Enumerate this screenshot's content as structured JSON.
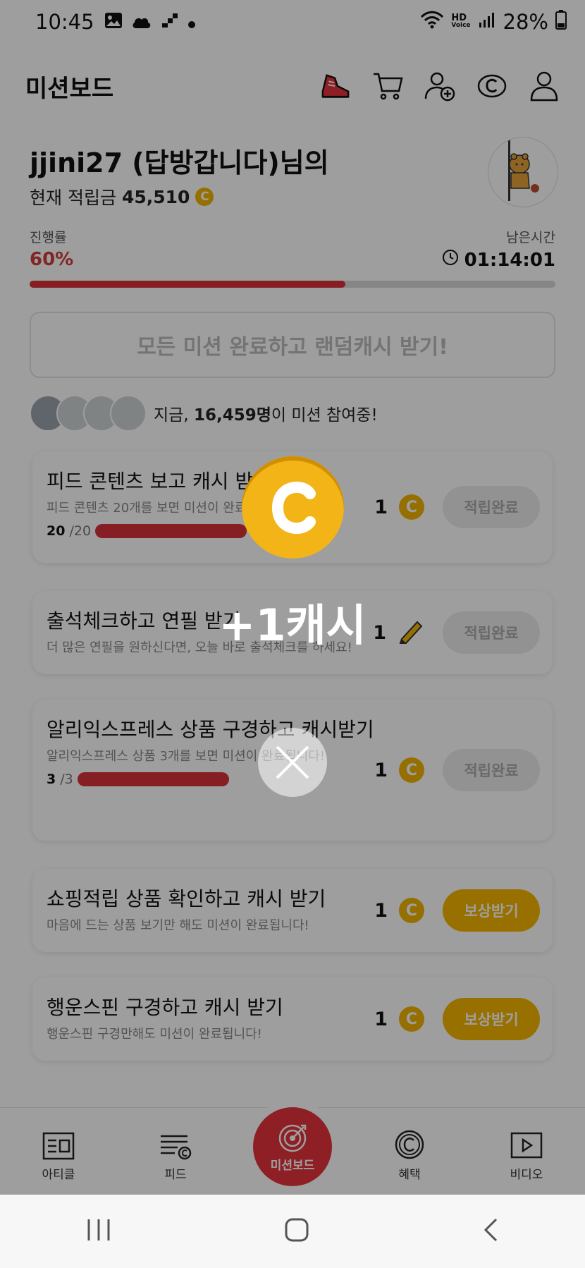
{
  "status_bar": {
    "time": "10:45",
    "battery": "28%",
    "network_label": "HD",
    "network_sub": "Voice",
    "left_icons": [
      "image-icon",
      "cloud-icon",
      "stairs-icon",
      "dot-icon"
    ],
    "right_icons": [
      "wifi-icon",
      "signal-icon",
      "battery-icon"
    ]
  },
  "header": {
    "title": "미션보드",
    "icons": [
      "sneaker-icon",
      "cart-icon",
      "add-friend-icon",
      "cash-c-icon",
      "profile-icon"
    ]
  },
  "profile": {
    "username": "jjini27 (답방갑니다)님의",
    "balance_label": "현재 적립금",
    "balance_value": "45,510",
    "coin_symbol": "C"
  },
  "progress": {
    "label": "진행률",
    "value": "60%",
    "fraction": 0.6,
    "time_label": "남은시간",
    "time_value": "01:14:01"
  },
  "all_missions_button": "모든 미션 완료하고 랜덤캐시 받기!",
  "participants": {
    "prefix": "지금, ",
    "count": "16,459명",
    "suffix": "이 미션 참여중!"
  },
  "missions": [
    {
      "title": "피드 콘텐츠 보고 캐시 받기",
      "subtitle": "피드 콘텐츠 20개를 보면 미션이 완료됩니다!",
      "progress_done": "20",
      "progress_total": "/20",
      "reward": "1",
      "reward_icon": "coin-icon",
      "button": "적립완료"
    },
    {
      "title": "출석체크하고 연필 받기",
      "subtitle": "더 많은 연필을 원하신다면, 오늘 바로 출석체크를 하세요!",
      "reward": "1",
      "reward_icon": "pencil-icon",
      "button": "적립완료"
    },
    {
      "title": "알리익스프레스 상품 구경하고 캐시받기",
      "subtitle": "알리익스프레스 상품 3개를 보면 미션이 완료됩니다!",
      "progress_done": "3",
      "progress_total": "/3",
      "reward": "1",
      "reward_icon": "coin-icon",
      "button": "적립완료"
    },
    {
      "title": "쇼핑적립 상품 확인하고 캐시 받기",
      "subtitle": "마음에 드는 상품 보기만 해도 미션이 완료됩니다!",
      "reward": "1",
      "reward_icon": "coin-icon",
      "button": "보상받기"
    },
    {
      "title": "행운스핀 구경하고 캐시 받기",
      "subtitle": "행운스핀 구경만해도 미션이 완료됩니다!",
      "reward": "1",
      "reward_icon": "coin-icon",
      "button": "보상받기"
    }
  ],
  "bottom_nav": {
    "items": [
      "아티클",
      "피드",
      "미션보드",
      "혜택",
      "비디오"
    ]
  },
  "overlay": {
    "reward_text": "+1캐시"
  },
  "colors": {
    "accent_red": "#d8323b",
    "coin_yellow": "#f3b418",
    "claim_yellow": "#f6b500"
  }
}
